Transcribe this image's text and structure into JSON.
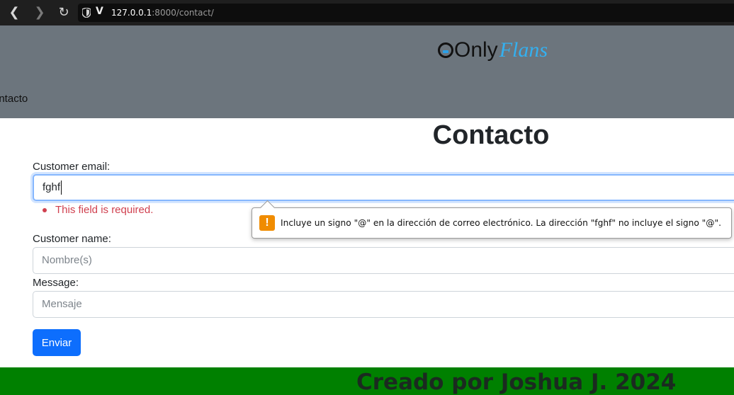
{
  "browser": {
    "url_host": "127.0.0.1",
    "url_rest": ":8000/contact/",
    "icons": [
      "back-icon",
      "forward-icon",
      "reload-icon",
      "shield-icon",
      "v-icon"
    ]
  },
  "header": {
    "logo_only": "Only",
    "logo_flans": "Flans",
    "nav_link": "ontacto"
  },
  "main": {
    "title": "Contacto",
    "email": {
      "label": "Customer email:",
      "value": "fghf",
      "error": "This field is required."
    },
    "name": {
      "label": "Customer name:",
      "placeholder": "Nombre(s)"
    },
    "message": {
      "label": "Message:",
      "placeholder": "Mensaje"
    },
    "submit_label": "Enviar"
  },
  "tooltip": {
    "text": "Incluye un signo \"@\" en la dirección de correo electrónico. La dirección \"fghf\" no incluye el signo \"@\".",
    "icon": "warning-icon"
  },
  "footer": {
    "text": "Creado por Joshua J. 2024"
  },
  "colors": {
    "header_bg": "#6c757d",
    "footer_bg": "#008000",
    "primary": "#0d6efd",
    "error": "#d0404f",
    "warning": "#f08c00"
  }
}
